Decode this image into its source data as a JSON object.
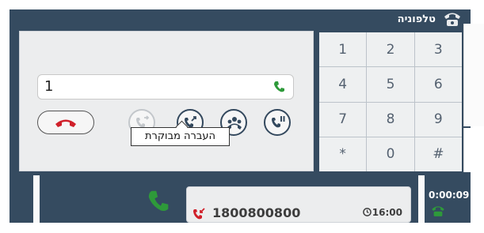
{
  "header": {
    "title": "טלפוניה",
    "icon": "telephone-icon"
  },
  "dialer": {
    "number_value": "1",
    "call_icon": "phone-icon",
    "hangup_icon": "hangup-icon",
    "buttons": [
      {
        "name": "transfer-disabled",
        "icon": "transfer-icon",
        "enabled": false
      },
      {
        "name": "supervised-transfer",
        "icon": "supervised-transfer-icon",
        "enabled": true
      },
      {
        "name": "conference",
        "icon": "conference-icon",
        "enabled": true
      },
      {
        "name": "hold",
        "icon": "hold-icon",
        "enabled": true
      }
    ],
    "tooltip": "העברה מבוקרת"
  },
  "keypad": {
    "keys": [
      "1",
      "2",
      "3",
      "4",
      "5",
      "6",
      "7",
      "8",
      "9",
      "*",
      "0",
      "#"
    ]
  },
  "active_call": {
    "number": "1800800800",
    "time": "16:00",
    "duration": "0:00:09"
  },
  "colors": {
    "panel_bg": "#354b60",
    "green": "#2e9a3a",
    "red": "#d0202a"
  }
}
